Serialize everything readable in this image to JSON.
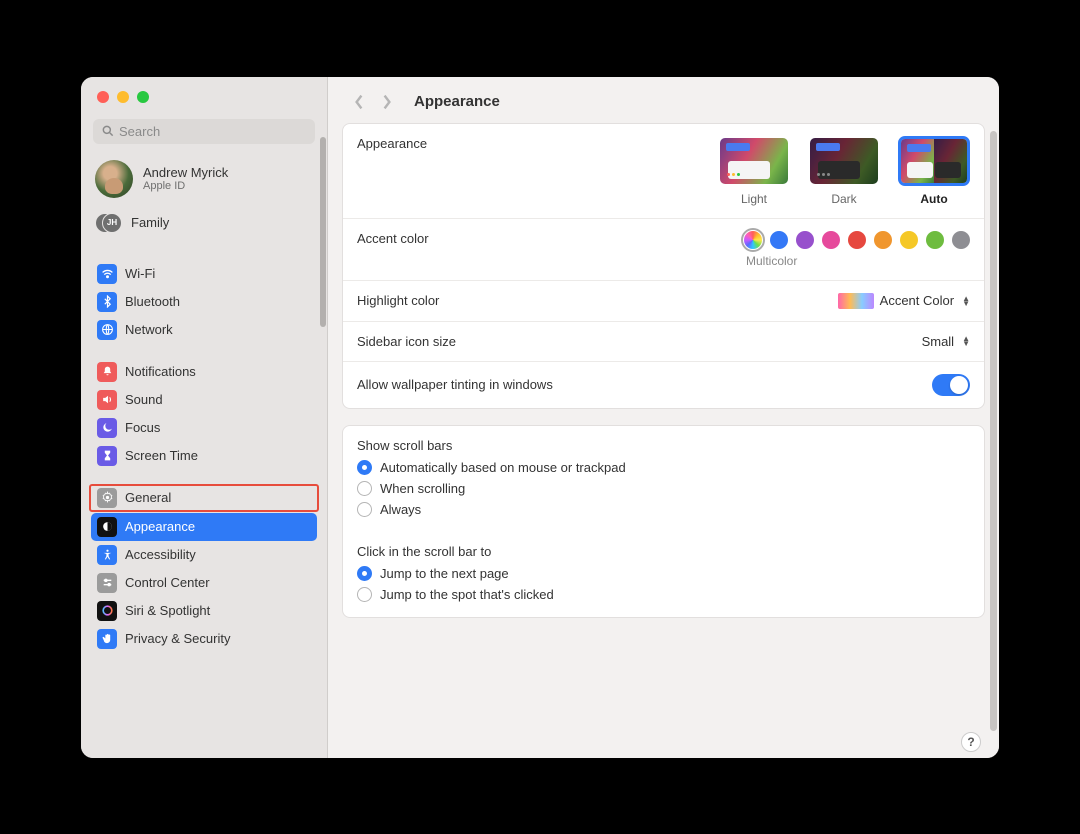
{
  "search": {
    "placeholder": "Search"
  },
  "profile": {
    "name": "Andrew Myrick",
    "sub": "Apple ID"
  },
  "family": {
    "label": "Family",
    "badge": "JH"
  },
  "sidebar": {
    "items": [
      {
        "label": "Wi-Fi",
        "color": "#2f7af6"
      },
      {
        "label": "Bluetooth",
        "color": "#2f7af6"
      },
      {
        "label": "Network",
        "color": "#2f7af6"
      },
      {
        "label": "Notifications",
        "color": "#ef5b5b"
      },
      {
        "label": "Sound",
        "color": "#ef5b5b"
      },
      {
        "label": "Focus",
        "color": "#6a5be6"
      },
      {
        "label": "Screen Time",
        "color": "#6a5be6"
      },
      {
        "label": "General",
        "color": "#9b9b9b"
      },
      {
        "label": "Appearance",
        "color": "#111"
      },
      {
        "label": "Accessibility",
        "color": "#2f7af6"
      },
      {
        "label": "Control Center",
        "color": "#9b9b9b"
      },
      {
        "label": "Siri & Spotlight",
        "color": "#111"
      },
      {
        "label": "Privacy & Security",
        "color": "#2f7af6"
      }
    ]
  },
  "header": {
    "title": "Appearance"
  },
  "appearance": {
    "label": "Appearance",
    "options": [
      {
        "label": "Light"
      },
      {
        "label": "Dark"
      },
      {
        "label": "Auto"
      }
    ],
    "selected": "Auto",
    "accent_label": "Accent color",
    "accent_selected_caption": "Multicolor",
    "accent_colors": [
      "#3478f6",
      "#9750cc",
      "#e64a9c",
      "#e6483f",
      "#f0962e",
      "#f5c827",
      "#6ebc3f",
      "#8e8e93"
    ],
    "highlight_label": "Highlight color",
    "highlight_value": "Accent Color",
    "sidebar_size_label": "Sidebar icon size",
    "sidebar_size_value": "Small",
    "tinting_label": "Allow wallpaper tinting in windows"
  },
  "scroll": {
    "show_label": "Show scroll bars",
    "show_options": [
      "Automatically based on mouse or trackpad",
      "When scrolling",
      "Always"
    ],
    "show_selected": 0,
    "click_label": "Click in the scroll bar to",
    "click_options": [
      "Jump to the next page",
      "Jump to the spot that's clicked"
    ],
    "click_selected": 0
  },
  "help": "?"
}
